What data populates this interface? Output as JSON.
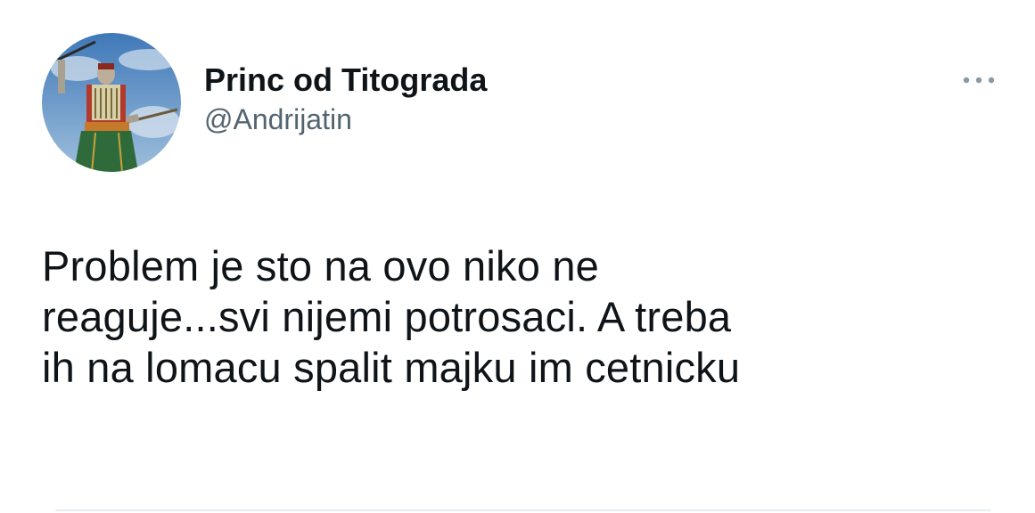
{
  "tweet": {
    "author": {
      "display_name": "Princ od Titograda",
      "handle": "@Andrijatin",
      "avatar": "avatar-photo-statue"
    },
    "more_icon": "more-horizontal-icon",
    "text": "Problem je sto na ovo niko ne\nreaguje...svi nijemi potrosaci. A treba\nih na lomacu spalit majku im cetnicku"
  },
  "colors": {
    "text_primary": "#0f1419",
    "text_secondary": "#536471",
    "divider": "#e6ecf0",
    "more_dots": "#8899a6"
  }
}
